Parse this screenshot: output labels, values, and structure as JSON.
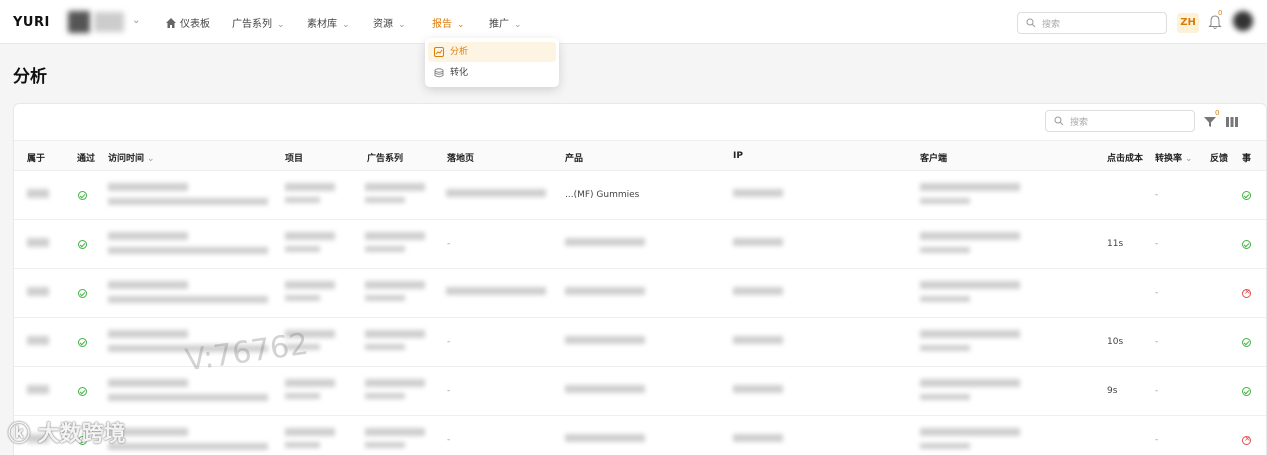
{
  "brand": "YURI",
  "nav": {
    "items": [
      {
        "label": "仪表板"
      },
      {
        "label": "广告系列"
      },
      {
        "label": "素材库"
      },
      {
        "label": "资源"
      },
      {
        "label": "报告"
      },
      {
        "label": "推广"
      }
    ],
    "active": "报告",
    "search_placeholder": "搜索",
    "lang": "ZH",
    "notif_count": "0"
  },
  "dropdown": {
    "items": [
      {
        "label": "分析",
        "selected": true
      },
      {
        "label": "转化",
        "selected": false
      }
    ]
  },
  "page": {
    "title": "分析"
  },
  "table": {
    "search_placeholder": "搜索",
    "filter_count": "0",
    "columns": [
      "属于",
      "通过",
      "访问时间",
      "项目",
      "广告系列",
      "落地页",
      "产品",
      "IP",
      "客户端",
      "点击成本",
      "转换率",
      "反馈",
      "事"
    ],
    "rows": [
      {
        "status": "ok",
        "landing": "",
        "product": "...(MF) Gummies",
        "cost": "",
        "conv": "-",
        "event": "ok"
      },
      {
        "status": "ok",
        "landing": "-",
        "product": "",
        "cost": "11s",
        "conv": "-",
        "event": "ok"
      },
      {
        "status": "ok",
        "landing": "",
        "product": "",
        "cost": "",
        "conv": "-",
        "event": "fail"
      },
      {
        "status": "ok",
        "landing": "-",
        "product": "",
        "cost": "10s",
        "conv": "-",
        "event": "ok"
      },
      {
        "status": "ok",
        "landing": "-",
        "product": "",
        "cost": "9s",
        "conv": "-",
        "event": "ok"
      },
      {
        "status": "ok",
        "landing": "-",
        "product": "",
        "cost": "",
        "conv": "-",
        "event": "fail"
      }
    ]
  },
  "watermark": "V:76762",
  "logo_text": "大数跨境",
  "colors": {
    "accent": "#d97d0b",
    "ok": "#43b243",
    "fail": "#e34d4d"
  }
}
